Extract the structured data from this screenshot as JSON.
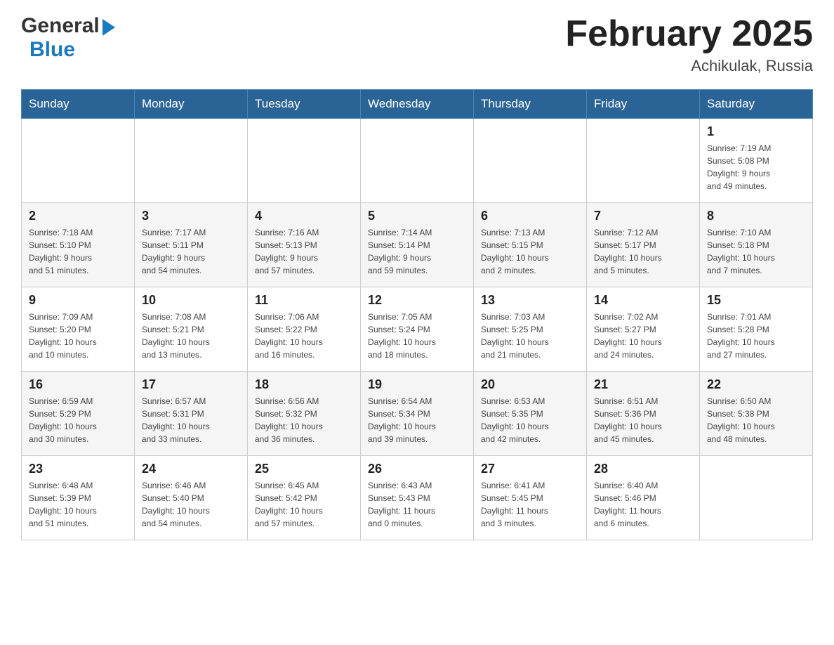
{
  "header": {
    "logo_general": "General",
    "logo_blue": "Blue",
    "month_title": "February 2025",
    "location": "Achikulak, Russia"
  },
  "weekdays": [
    "Sunday",
    "Monday",
    "Tuesday",
    "Wednesday",
    "Thursday",
    "Friday",
    "Saturday"
  ],
  "weeks": [
    [
      {
        "day": "",
        "info": ""
      },
      {
        "day": "",
        "info": ""
      },
      {
        "day": "",
        "info": ""
      },
      {
        "day": "",
        "info": ""
      },
      {
        "day": "",
        "info": ""
      },
      {
        "day": "",
        "info": ""
      },
      {
        "day": "1",
        "info": "Sunrise: 7:19 AM\nSunset: 5:08 PM\nDaylight: 9 hours\nand 49 minutes."
      }
    ],
    [
      {
        "day": "2",
        "info": "Sunrise: 7:18 AM\nSunset: 5:10 PM\nDaylight: 9 hours\nand 51 minutes."
      },
      {
        "day": "3",
        "info": "Sunrise: 7:17 AM\nSunset: 5:11 PM\nDaylight: 9 hours\nand 54 minutes."
      },
      {
        "day": "4",
        "info": "Sunrise: 7:16 AM\nSunset: 5:13 PM\nDaylight: 9 hours\nand 57 minutes."
      },
      {
        "day": "5",
        "info": "Sunrise: 7:14 AM\nSunset: 5:14 PM\nDaylight: 9 hours\nand 59 minutes."
      },
      {
        "day": "6",
        "info": "Sunrise: 7:13 AM\nSunset: 5:15 PM\nDaylight: 10 hours\nand 2 minutes."
      },
      {
        "day": "7",
        "info": "Sunrise: 7:12 AM\nSunset: 5:17 PM\nDaylight: 10 hours\nand 5 minutes."
      },
      {
        "day": "8",
        "info": "Sunrise: 7:10 AM\nSunset: 5:18 PM\nDaylight: 10 hours\nand 7 minutes."
      }
    ],
    [
      {
        "day": "9",
        "info": "Sunrise: 7:09 AM\nSunset: 5:20 PM\nDaylight: 10 hours\nand 10 minutes."
      },
      {
        "day": "10",
        "info": "Sunrise: 7:08 AM\nSunset: 5:21 PM\nDaylight: 10 hours\nand 13 minutes."
      },
      {
        "day": "11",
        "info": "Sunrise: 7:06 AM\nSunset: 5:22 PM\nDaylight: 10 hours\nand 16 minutes."
      },
      {
        "day": "12",
        "info": "Sunrise: 7:05 AM\nSunset: 5:24 PM\nDaylight: 10 hours\nand 18 minutes."
      },
      {
        "day": "13",
        "info": "Sunrise: 7:03 AM\nSunset: 5:25 PM\nDaylight: 10 hours\nand 21 minutes."
      },
      {
        "day": "14",
        "info": "Sunrise: 7:02 AM\nSunset: 5:27 PM\nDaylight: 10 hours\nand 24 minutes."
      },
      {
        "day": "15",
        "info": "Sunrise: 7:01 AM\nSunset: 5:28 PM\nDaylight: 10 hours\nand 27 minutes."
      }
    ],
    [
      {
        "day": "16",
        "info": "Sunrise: 6:59 AM\nSunset: 5:29 PM\nDaylight: 10 hours\nand 30 minutes."
      },
      {
        "day": "17",
        "info": "Sunrise: 6:57 AM\nSunset: 5:31 PM\nDaylight: 10 hours\nand 33 minutes."
      },
      {
        "day": "18",
        "info": "Sunrise: 6:56 AM\nSunset: 5:32 PM\nDaylight: 10 hours\nand 36 minutes."
      },
      {
        "day": "19",
        "info": "Sunrise: 6:54 AM\nSunset: 5:34 PM\nDaylight: 10 hours\nand 39 minutes."
      },
      {
        "day": "20",
        "info": "Sunrise: 6:53 AM\nSunset: 5:35 PM\nDaylight: 10 hours\nand 42 minutes."
      },
      {
        "day": "21",
        "info": "Sunrise: 6:51 AM\nSunset: 5:36 PM\nDaylight: 10 hours\nand 45 minutes."
      },
      {
        "day": "22",
        "info": "Sunrise: 6:50 AM\nSunset: 5:38 PM\nDaylight: 10 hours\nand 48 minutes."
      }
    ],
    [
      {
        "day": "23",
        "info": "Sunrise: 6:48 AM\nSunset: 5:39 PM\nDaylight: 10 hours\nand 51 minutes."
      },
      {
        "day": "24",
        "info": "Sunrise: 6:46 AM\nSunset: 5:40 PM\nDaylight: 10 hours\nand 54 minutes."
      },
      {
        "day": "25",
        "info": "Sunrise: 6:45 AM\nSunset: 5:42 PM\nDaylight: 10 hours\nand 57 minutes."
      },
      {
        "day": "26",
        "info": "Sunrise: 6:43 AM\nSunset: 5:43 PM\nDaylight: 11 hours\nand 0 minutes."
      },
      {
        "day": "27",
        "info": "Sunrise: 6:41 AM\nSunset: 5:45 PM\nDaylight: 11 hours\nand 3 minutes."
      },
      {
        "day": "28",
        "info": "Sunrise: 6:40 AM\nSunset: 5:46 PM\nDaylight: 11 hours\nand 6 minutes."
      },
      {
        "day": "",
        "info": ""
      }
    ]
  ]
}
